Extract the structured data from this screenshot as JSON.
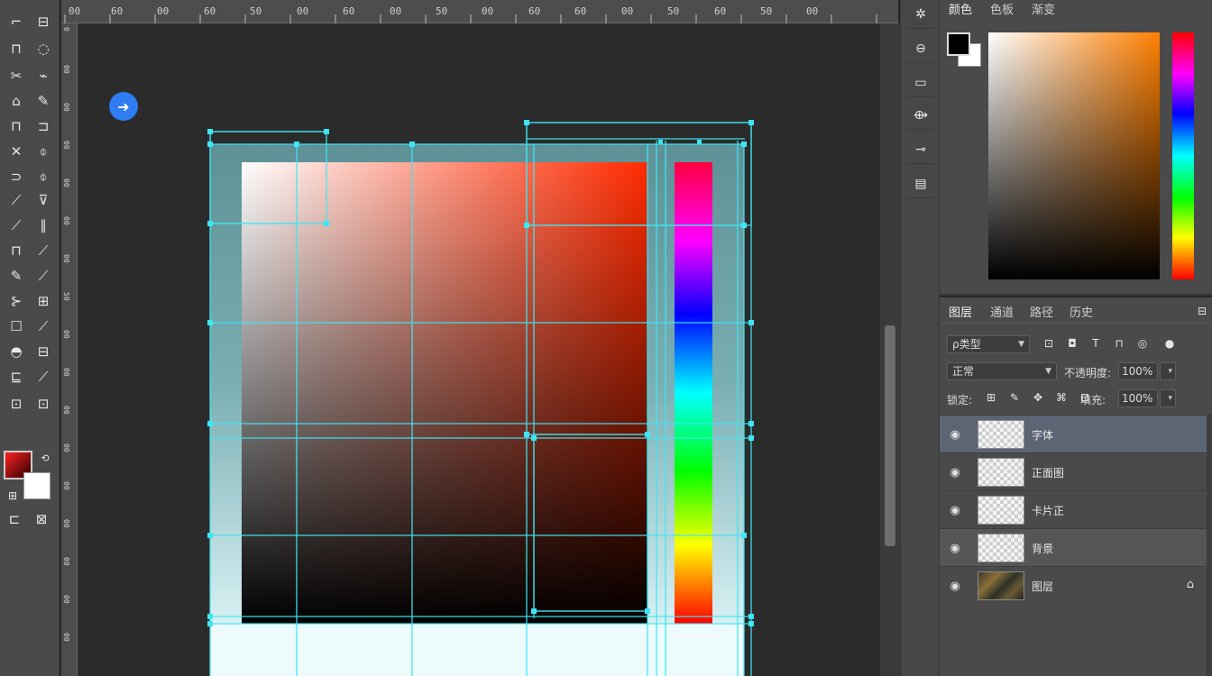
{
  "toolbar": {
    "tools": [
      "⌐",
      "⊟",
      "⊓",
      "◌",
      "✂",
      "⌁",
      "⌂",
      "✎",
      "⊓",
      "⊐",
      "✕",
      "⌽",
      "⊃",
      "⌽",
      "⟋",
      "⊽",
      "⟋",
      "∥",
      "⊓",
      "⟋",
      "✎",
      "⟋",
      "⊱",
      "⊞",
      "☐",
      "⟋",
      "◓",
      "⊟",
      "⊑",
      "⟋",
      "⊡",
      "⊡"
    ],
    "swap_label": "⟲",
    "mode_label": "⊞",
    "quickmask_label": "⊏",
    "screen_label": "⊠"
  },
  "ruler": {
    "top_numbers": [
      "00",
      "60",
      "00",
      "60",
      "50",
      "00",
      "60",
      "00",
      "50",
      "00",
      "60",
      "60",
      "00",
      "50",
      "60",
      "50",
      "00"
    ],
    "left_numbers": [
      "0",
      "00",
      "00",
      "00",
      "00",
      "00",
      "00",
      "50",
      "00",
      "00",
      "00",
      "00",
      "00",
      "00",
      "00",
      "00",
      "00"
    ]
  },
  "canvas": {
    "go_button_glyph": "➜"
  },
  "icon_panel": {
    "buttons": [
      "✲",
      "⊖",
      "▭",
      "⟴",
      "⊸",
      "▤"
    ]
  },
  "color_panel": {
    "tabs": [
      "颜色",
      "色板",
      "渐变"
    ],
    "fg_color": "#000000",
    "bg_color": "#ffffff"
  },
  "layers_panel": {
    "tabs": [
      "图层",
      "通道",
      "路径",
      "历史"
    ],
    "collapse_glyph": "⊟",
    "kind_filter": "ρ类型",
    "filter_icons": [
      "⊡",
      "◘",
      "T",
      "⊓",
      "◎",
      "●"
    ],
    "blend_mode": "正常",
    "opacity_label": "不透明度:",
    "opacity_value": "100%",
    "lock_label": "锁定:",
    "lock_icons": [
      "⊞",
      "✎",
      "✥",
      "⌘",
      "⊡"
    ],
    "fill_label": "填充:",
    "fill_value": "100%",
    "layers": [
      {
        "name": "字体",
        "visible": true,
        "thumb": "transparent",
        "state": "selected"
      },
      {
        "name": "正面图",
        "visible": true,
        "thumb": "transparent",
        "state": "normal"
      },
      {
        "name": "卡片正",
        "visible": true,
        "thumb": "transparent",
        "state": "normal"
      },
      {
        "name": "背景",
        "visible": true,
        "thumb": "transparent",
        "state": "hovered"
      },
      {
        "name": "图层",
        "visible": true,
        "thumb": "photo",
        "state": "normal",
        "locked": true
      }
    ],
    "eye_glyph": "◉",
    "lock_glyph": "⌂"
  },
  "colors": {
    "guide": "#3ee6f5",
    "selection_blue": "#5b6573"
  }
}
